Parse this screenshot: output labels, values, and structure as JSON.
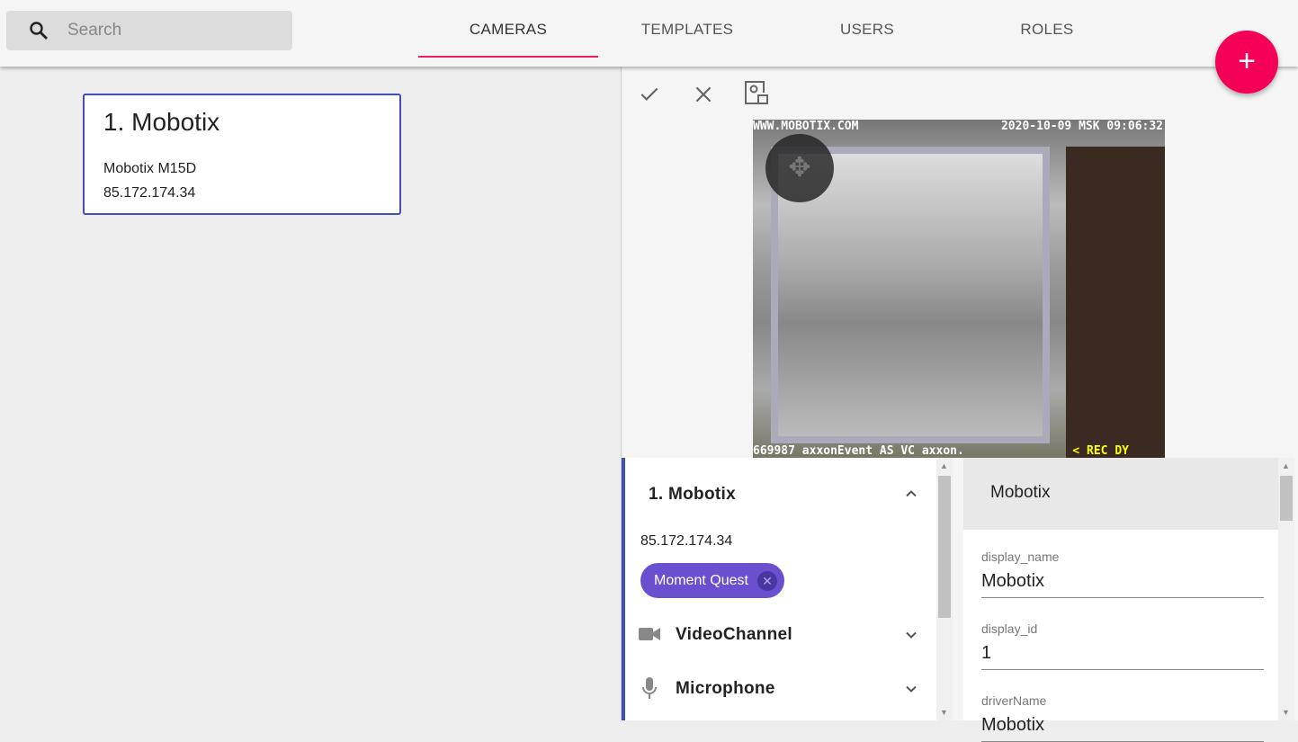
{
  "search": {
    "placeholder": "Search"
  },
  "tabs": [
    "CAMERAS",
    "TEMPLATES",
    "USERS",
    "ROLES"
  ],
  "fab": "+",
  "camera_card": {
    "title": "1. Mobotix",
    "model": "Mobotix M15D",
    "ip": "85.172.174.34"
  },
  "video": {
    "osd_top_left": "WWW.MOBOTIX.COM",
    "osd_top_right": "2020-10-09 MSK 09:06:32",
    "osd_bottom_left": "669987 axxonEvent AS VC axxon.",
    "osd_bottom_right": "< REC DY"
  },
  "device": {
    "title": "1. Mobotix",
    "ip": "85.172.174.34",
    "chip": "Moment Quest",
    "sections": [
      "VideoChannel",
      "Microphone"
    ]
  },
  "props": {
    "header": "Mobotix",
    "fields": [
      {
        "label": "display_name",
        "value": "Mobotix"
      },
      {
        "label": "display_id",
        "value": "1"
      },
      {
        "label": "driverName",
        "value": "Mobotix"
      }
    ]
  },
  "colors": {
    "accent": "#e91e63",
    "fab": "#f50057",
    "primary": "#3f51b5",
    "chip": "#6a4fcf"
  }
}
